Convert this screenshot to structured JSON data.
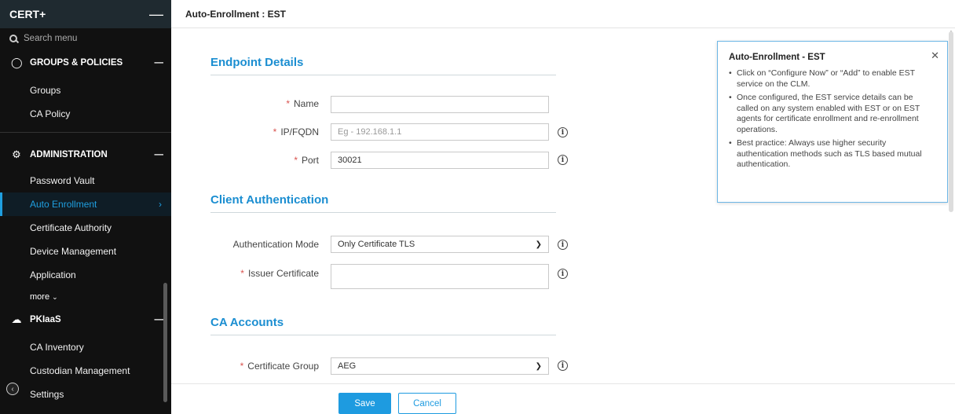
{
  "sidebar": {
    "title": "CERT+",
    "search_placeholder": "Search menu",
    "sections": [
      {
        "label": "GROUPS & POLICIES",
        "items": [
          "Groups",
          "CA Policy"
        ]
      },
      {
        "label": "ADMINISTRATION",
        "items": [
          "Password Vault",
          "Auto Enrollment",
          "Certificate Authority",
          "Device Management",
          "Application"
        ],
        "more": "more"
      },
      {
        "label": "PKIaaS",
        "items": [
          "CA Inventory",
          "Custodian Management",
          "Settings"
        ]
      }
    ],
    "active_item": "Auto Enrollment"
  },
  "page_title": "Auto-Enrollment : EST",
  "form": {
    "endpoint": {
      "title": "Endpoint Details",
      "name_label": "Name",
      "name_value": "",
      "ip_label": "IP/FQDN",
      "ip_placeholder": "Eg - 192.168.1.1",
      "port_label": "Port",
      "port_value": "30021"
    },
    "client_auth": {
      "title": "Client Authentication",
      "mode_label": "Authentication Mode",
      "mode_value": "Only Certificate TLS",
      "issuer_label": "Issuer Certificate",
      "issuer_value": ""
    },
    "ca_accounts": {
      "title": "CA Accounts",
      "group_label": "Certificate Group",
      "group_value": "AEG"
    }
  },
  "help": {
    "title": "Auto-Enrollment - EST",
    "bullets": [
      "Click on “Configure Now” or “Add” to enable EST service on the CLM.",
      "Once configured, the EST service details can be called on any system enabled with EST or on EST agents for certificate enrollment and re-enrollment operations.",
      "Best practice: Always use higher security authentication methods such as TLS based mutual authentication."
    ]
  },
  "footer": {
    "save_label": "Save",
    "cancel_label": "Cancel"
  },
  "colors": {
    "accent": "#1e9be0",
    "sidebar_bg": "#111111",
    "required": "#d9534f"
  }
}
